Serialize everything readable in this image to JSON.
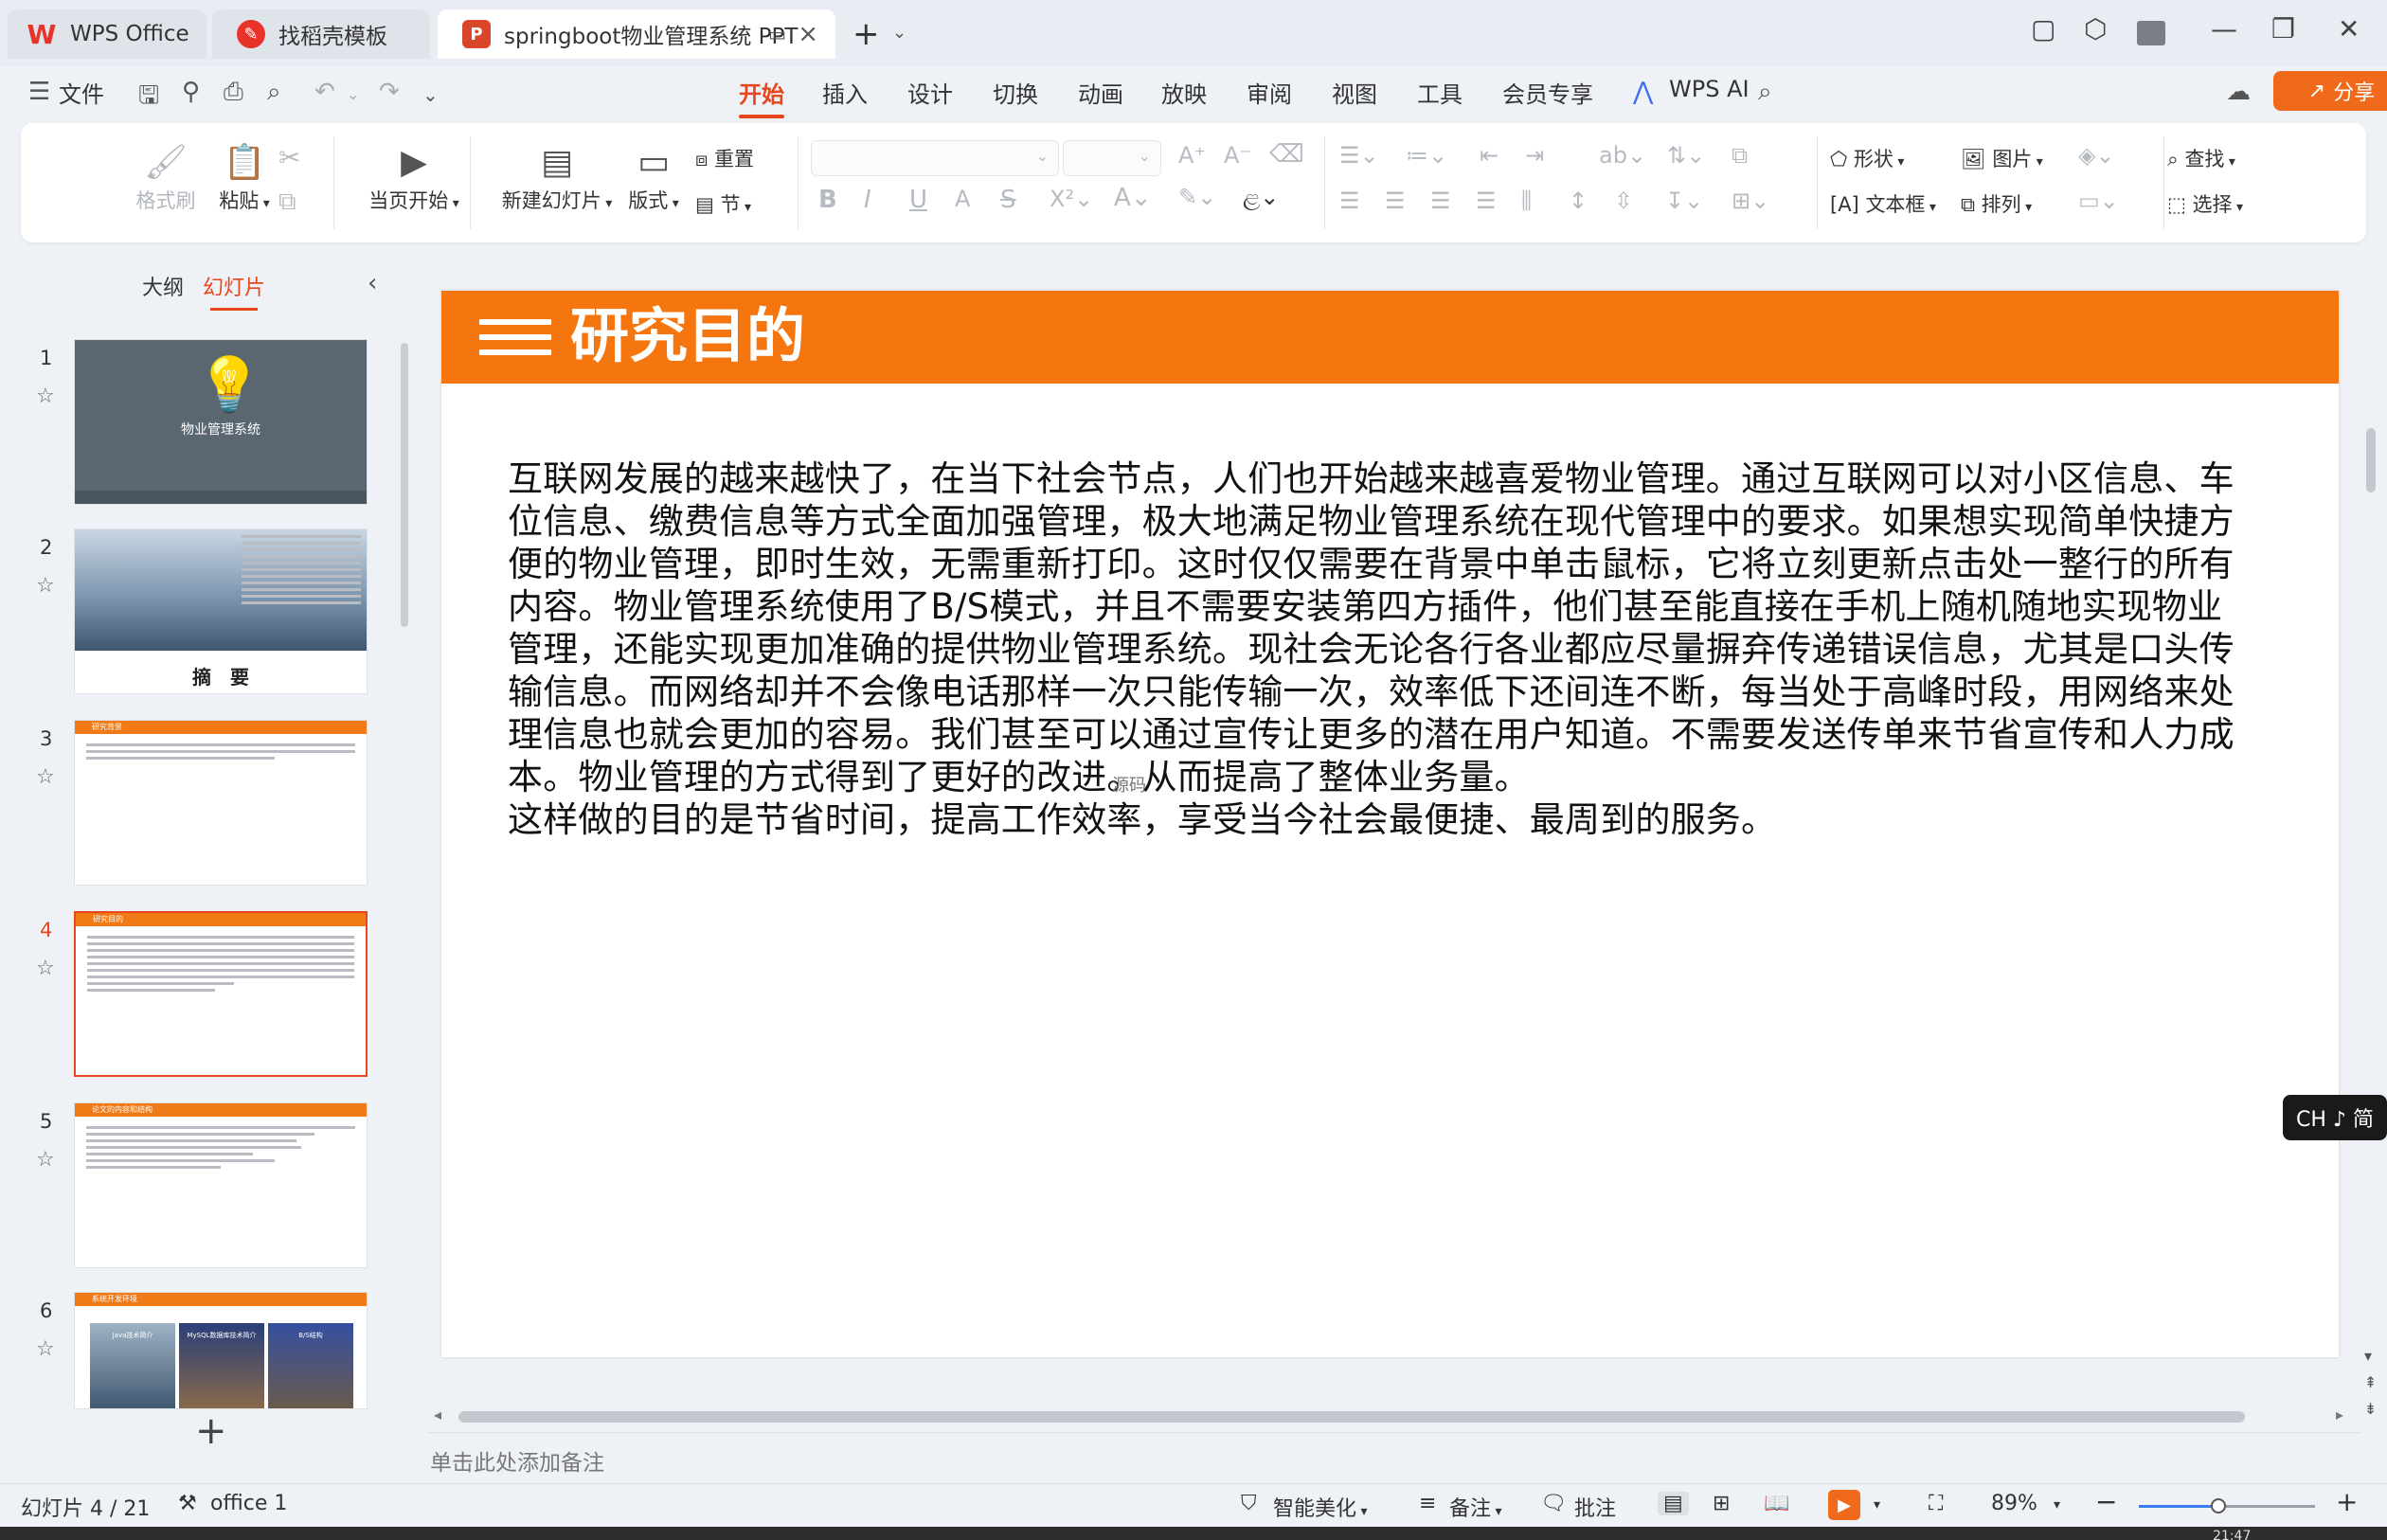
{
  "tabs": [
    {
      "label": "WPS Office"
    },
    {
      "label": "找稻壳模板"
    },
    {
      "label": "springboot物业管理系统 PPT"
    }
  ],
  "menu": {
    "file": "文件",
    "items": [
      "开始",
      "插入",
      "设计",
      "切换",
      "动画",
      "放映",
      "审阅",
      "视图",
      "工具",
      "会员专享"
    ],
    "active": "开始",
    "wps_ai": "WPS AI",
    "share": "分享"
  },
  "ribbon": {
    "format_painter": "格式刷",
    "paste": "粘贴",
    "from_current": "当页开始",
    "new_slide": "新建幻灯片",
    "layout": "版式",
    "reset": "重置",
    "section": "节",
    "shape": "形状",
    "picture": "图片",
    "find": "查找",
    "textbox": "文本框",
    "arrange": "排列",
    "select": "选择"
  },
  "panel": {
    "outline_tab": "大纲",
    "slides_tab": "幻灯片"
  },
  "thumbnails": [
    {
      "num": "1",
      "text": "物业管理系统"
    },
    {
      "num": "2",
      "text": "摘　要"
    },
    {
      "num": "3",
      "text": "研究背景"
    },
    {
      "num": "4",
      "text": "研究目的"
    },
    {
      "num": "5",
      "text": "论文的内容和结构"
    },
    {
      "num": "6",
      "text": "系统开发环境",
      "cards": [
        "Java技术简介",
        "MySQL数据库技术简介",
        "B/S结构"
      ]
    }
  ],
  "slide": {
    "title": "研究目的",
    "lines": [
      "互联网发展的越来越快了，在当下社会节点，人们也开始越来越喜爱物业管理。通过互联网可以对小区信息、车",
      "位信息、缴费信息等方式全面加强管理，极大地满足物业管理系统在现代管理中的要求。如果想实现简单快捷方",
      "便的物业管理，即时生效，无需重新打印。这时仅仅需要在背景中单击鼠标，它将立刻更新点击处一整行的所有",
      "内容。物业管理系统使用了B/S模式，并且不需要安装第四方插件，他们甚至能直接在手机上随机随地实现物业",
      "管理，还能实现更加准确的提供物业管理系统。现社会无论各行各业都应尽量摒弃传递错误信息，尤其是口头传",
      "输信息。而网络却并不会像电话那样一次只能传输一次，效率低下还间连不断，每当处于高峰时段，用网络来处",
      "理信息也就会更加的容易。我们甚至可以通过宣传让更多的潜在用户知道。不需要发送传单来节省宣传和人力成",
      "本。物业管理的方式得到了更好的改进。从而提高了整体业务量。",
      "这样做的目的是节省时间，提高工作效率，享受当今社会最便捷、最周到的服务。"
    ],
    "watermark": "源码"
  },
  "ime": "CH ♪ 简",
  "notes_placeholder": "单击此处添加备注",
  "status": {
    "slide_info": "幻灯片 4 / 21",
    "theme": "office 1",
    "beautify": "智能美化",
    "notes": "备注",
    "comments": "批注",
    "zoom": "89%",
    "zoom_fraction": 0.45
  },
  "clock": "21:47"
}
